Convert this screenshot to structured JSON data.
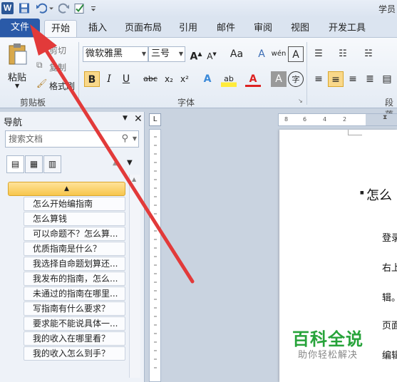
{
  "title_bar": {
    "title_partial": "学员"
  },
  "tabs": [
    {
      "label": "文件"
    },
    {
      "label": "开始"
    },
    {
      "label": "插入"
    },
    {
      "label": "页面布局"
    },
    {
      "label": "引用"
    },
    {
      "label": "邮件"
    },
    {
      "label": "审阅"
    },
    {
      "label": "视图"
    },
    {
      "label": "开发工具"
    }
  ],
  "ribbon": {
    "clipboard": {
      "paste": "粘贴",
      "cut": "剪切",
      "copy": "复制",
      "format_painter": "格式刷",
      "group_label": "剪贴板"
    },
    "font": {
      "font_name": "微软雅黑",
      "font_size": "三号",
      "grow": "A",
      "shrink": "A",
      "case": "Aa",
      "clear": "A",
      "phonetic": "wén",
      "border": "A",
      "bold": "B",
      "italic": "I",
      "underline": "U",
      "strike": "abc",
      "sub": "x₂",
      "sup": "x²",
      "effects": "A",
      "highlight": "ab",
      "color": "A",
      "shade": "A",
      "enclose": "字",
      "group_label": "字体"
    },
    "paragraph": {
      "group_label": "段落"
    }
  },
  "nav": {
    "title": "导航",
    "search_placeholder": "搜索文档",
    "collapse_glyph": "▲",
    "items": [
      "怎么开始编指南",
      "怎么算钱",
      "可以命题不？怎么算...",
      "优质指南是什么？",
      "我选择自命题划算还...",
      "我发布的指南，怎么...",
      "未通过的指南在哪里...",
      "写指南有什么要求？",
      "要求能不能说具体一...",
      "我的收入在哪里看？",
      "我的收入怎么到手？"
    ]
  },
  "ruler": {
    "ticks": [
      "8",
      "6",
      "4",
      "2"
    ],
    "button": "L"
  },
  "document": {
    "heading": "怎么",
    "lines": [
      "登录",
      "右上",
      "辑。",
      "页面",
      "编辑"
    ]
  },
  "watermark": {
    "title": "百科全说",
    "subtitle": "助你轻松解决"
  },
  "colors": {
    "file_tab": "#2a5aa8",
    "arrow": "#e23a3a",
    "watermark_green": "#27a33a",
    "collapse_bar": "#f7c64c"
  }
}
